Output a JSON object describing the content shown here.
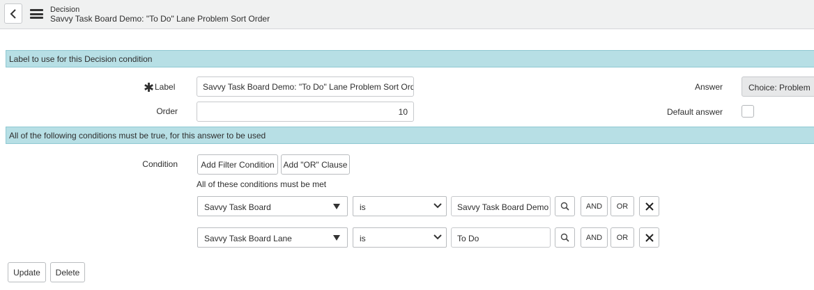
{
  "header": {
    "type_label": "Decision",
    "title": "Savvy Task Board Demo: \"To Do\" Lane Problem Sort Order"
  },
  "sections": {
    "label_section": "Label to use for this Decision condition",
    "conditions_section": "All of the following conditions must be true, for this answer to be used"
  },
  "form": {
    "label_field_label": "Label",
    "label_value": "Savvy Task Board Demo: \"To Do\" Lane Problem Sort Order",
    "order_field_label": "Order",
    "order_value": "10",
    "answer_field_label": "Answer",
    "answer_value": "Choice: Problem",
    "default_answer_label": "Default answer",
    "default_answer_checked": false
  },
  "condition": {
    "field_label": "Condition",
    "add_filter_label": "Add Filter Condition",
    "add_or_label": "Add \"OR\" Clause",
    "hint": "All of these conditions must be met",
    "rows": [
      {
        "field": "Savvy Task Board",
        "operator": "is",
        "value": "Savvy Task Board Demo",
        "and_label": "AND",
        "or_label": "OR"
      },
      {
        "field": "Savvy Task Board Lane",
        "operator": "is",
        "value": "To Do",
        "and_label": "AND",
        "or_label": "OR"
      }
    ]
  },
  "actions": {
    "update_label": "Update",
    "delete_label": "Delete"
  },
  "icons": {
    "back": "chevron-left-icon",
    "menu": "hamburger-menu-icon",
    "search": "search-icon",
    "remove": "close-icon",
    "required": "asterisk-icon"
  },
  "colors": {
    "section_bar": "#b7dfe5",
    "header_bg": "#f0f1f1"
  }
}
